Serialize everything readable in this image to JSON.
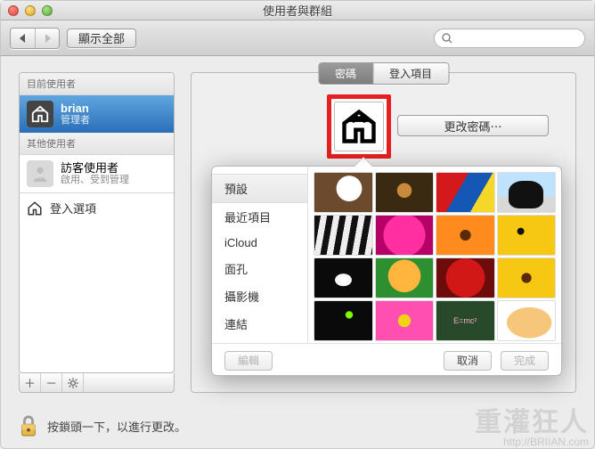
{
  "window": {
    "title": "使用者與群組"
  },
  "toolbar": {
    "show_all": "顯示全部",
    "search_placeholder": ""
  },
  "sidebar": {
    "section_current": "目前使用者",
    "section_other": "其他使用者",
    "current_user": {
      "name": "brian",
      "role": "管理者"
    },
    "guest": {
      "name": "訪客使用者",
      "role": "啟用、受到管理"
    },
    "login_options": "登入選項"
  },
  "content": {
    "tabs": {
      "password": "密碼",
      "login_items": "登入項目"
    },
    "change_password": "更改密碼⋯"
  },
  "picker": {
    "categories": [
      "預設",
      "最近項目",
      "iCloud",
      "面孔",
      "攝影機",
      "連結"
    ],
    "selected_index": 0,
    "edit": "編輯",
    "cancel": "取消",
    "done": "完成",
    "chalkboard_text": "E=mc²"
  },
  "lock": {
    "hint": "按鎖頭一下，以進行更改。"
  },
  "watermark": {
    "name": "重灌狂人",
    "url": "http://BRIIAN.com"
  }
}
